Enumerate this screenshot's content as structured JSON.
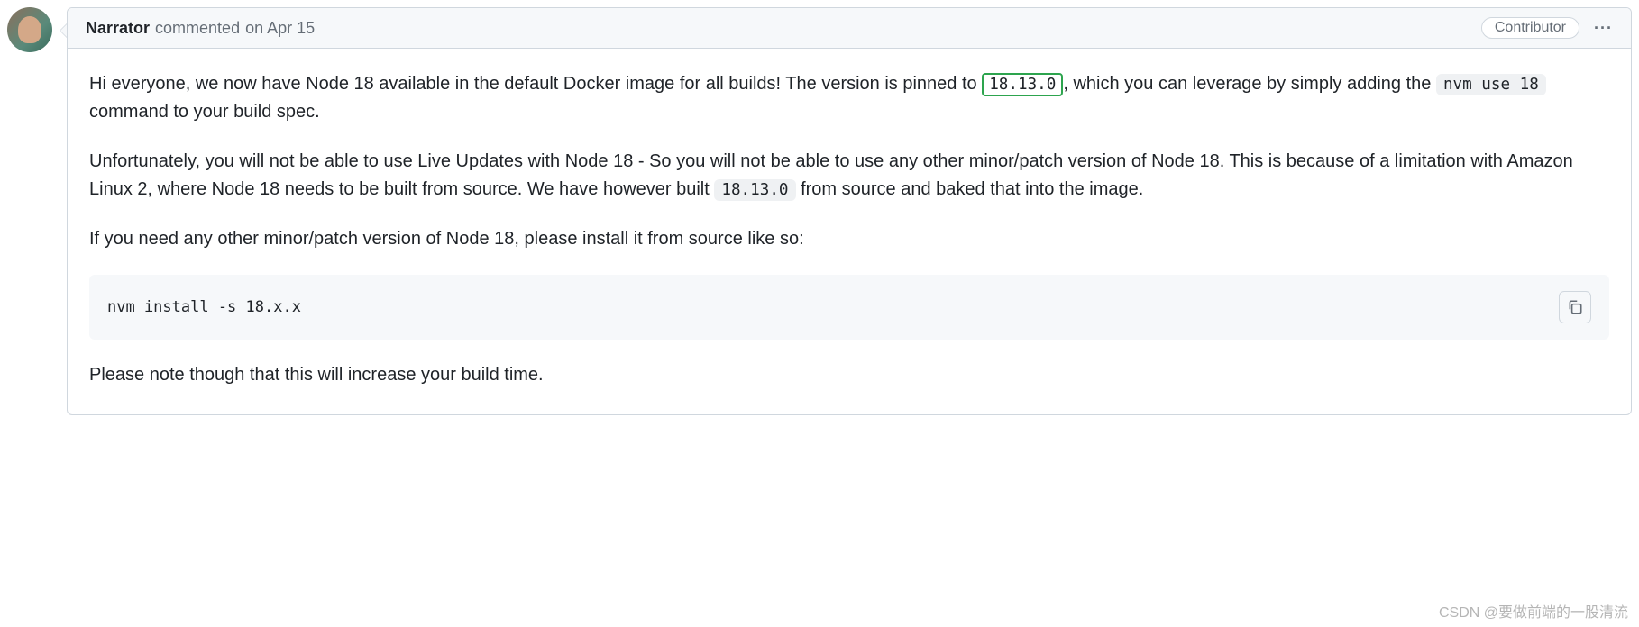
{
  "header": {
    "author": "Narrator",
    "action_prefix": "commented",
    "timestamp": "on Apr 15",
    "badge": "Contributor",
    "kebab": "···"
  },
  "body": {
    "p1_a": "Hi everyone, we now have Node 18 available in the default Docker image for all builds! The version is pinned to ",
    "p1_code_highlight": "18.13.0",
    "p1_b": ", which you can leverage by simply adding the ",
    "p1_code_inline": "nvm use 18",
    "p1_c": " command to your build spec.",
    "p2_a": "Unfortunately, you will not be able to use Live Updates with Node 18 - So you will not be able to use any other minor/patch version of Node 18. This is because of a limitation with Amazon Linux 2, where Node 18 needs to be built from source. We have however built ",
    "p2_code_inline": "18.13.0",
    "p2_b": " from source and baked that into the image.",
    "p3": "If you need any other minor/patch version of Node 18, please install it from source like so:",
    "code_block": "nvm install -s 18.x.x",
    "p4": "Please note though that this will increase your build time."
  },
  "watermark": "CSDN @要做前端的一股清流"
}
